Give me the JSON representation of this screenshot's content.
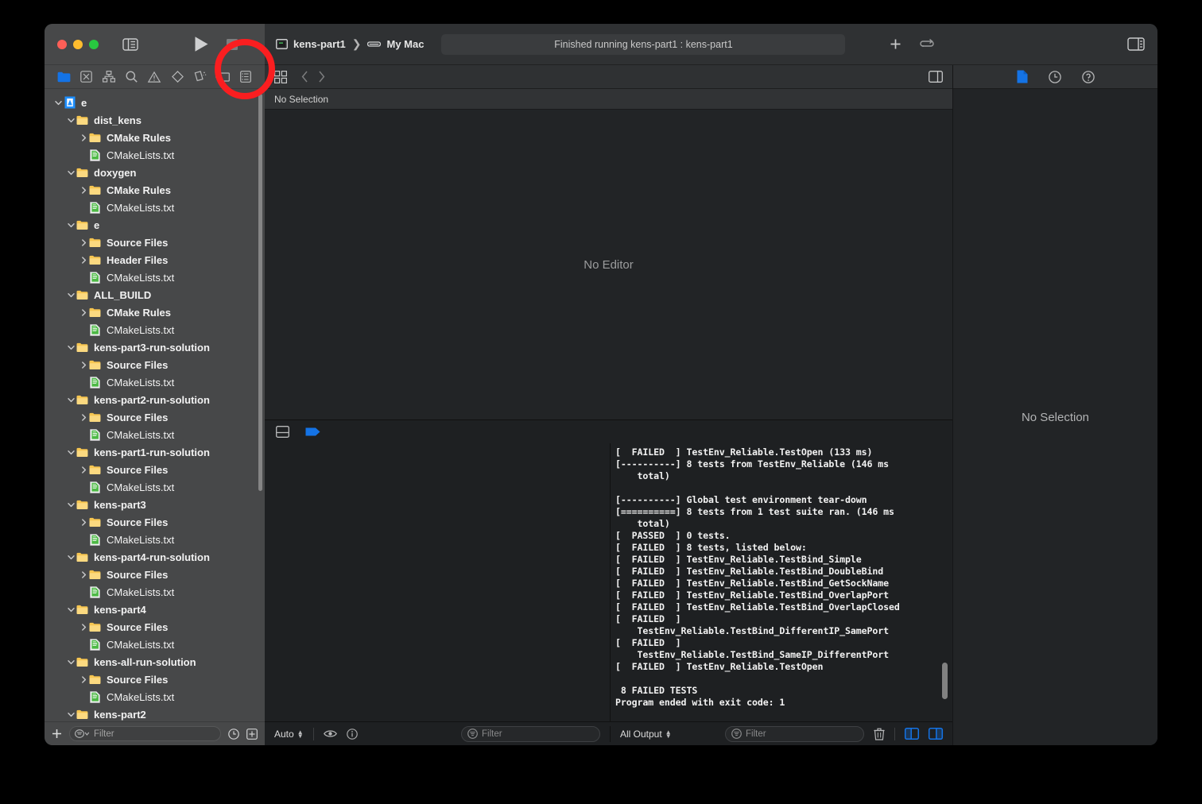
{
  "window": {
    "traffic_lights": [
      "close",
      "minimize",
      "zoom"
    ],
    "colors": {
      "close": "#ff5f57",
      "minimize": "#febc2e",
      "zoom": "#28c840",
      "accent": "#0a84ff",
      "annotation": "#fa1e20"
    }
  },
  "toolbar": {
    "sidebar_toggle_icon": "sidebar-left-icon",
    "run_icon": "play-icon",
    "stop_icon": "stop-icon",
    "scheme_name": "kens-part1",
    "scheme_separator": "❯",
    "destination": "My Mac",
    "activity_status": "Finished running kens-part1 : kens-part1",
    "add_icon": "plus-icon",
    "swap_icon": "swap-arrows-icon",
    "inspector_toggle_icon": "sidebar-right-icon"
  },
  "navigator": {
    "tabs": [
      {
        "name": "project-navigator",
        "icon": "folder-icon",
        "active": true
      },
      {
        "name": "source-control-navigator",
        "icon": "source-control-icon",
        "active": false
      },
      {
        "name": "symbol-navigator",
        "icon": "hierarchy-icon",
        "active": false
      },
      {
        "name": "find-navigator",
        "icon": "search-icon",
        "active": false
      },
      {
        "name": "issue-navigator",
        "icon": "warning-triangle-icon",
        "active": false
      },
      {
        "name": "test-navigator",
        "icon": "diamond-icon",
        "active": false
      },
      {
        "name": "debug-navigator",
        "icon": "debug-icon",
        "active": false
      },
      {
        "name": "breakpoint-navigator",
        "icon": "tag-icon",
        "active": false
      },
      {
        "name": "report-navigator",
        "icon": "list-icon",
        "active": false
      }
    ],
    "tree": [
      {
        "label": "e",
        "depth": 0,
        "type": "project",
        "twisty": "down"
      },
      {
        "label": "dist_kens",
        "depth": 1,
        "type": "folder",
        "twisty": "down"
      },
      {
        "label": "CMake Rules",
        "depth": 2,
        "type": "folder",
        "twisty": "right"
      },
      {
        "label": "CMakeLists.txt",
        "depth": 2,
        "type": "file",
        "twisty": "none"
      },
      {
        "label": "doxygen",
        "depth": 1,
        "type": "folder",
        "twisty": "down"
      },
      {
        "label": "CMake Rules",
        "depth": 2,
        "type": "folder",
        "twisty": "right"
      },
      {
        "label": "CMakeLists.txt",
        "depth": 2,
        "type": "file",
        "twisty": "none"
      },
      {
        "label": "e",
        "depth": 1,
        "type": "folder",
        "twisty": "down"
      },
      {
        "label": "Source Files",
        "depth": 2,
        "type": "folder",
        "twisty": "right"
      },
      {
        "label": "Header Files",
        "depth": 2,
        "type": "folder",
        "twisty": "right"
      },
      {
        "label": "CMakeLists.txt",
        "depth": 2,
        "type": "file",
        "twisty": "none"
      },
      {
        "label": "ALL_BUILD",
        "depth": 1,
        "type": "folder",
        "twisty": "down"
      },
      {
        "label": "CMake Rules",
        "depth": 2,
        "type": "folder",
        "twisty": "right"
      },
      {
        "label": "CMakeLists.txt",
        "depth": 2,
        "type": "file",
        "twisty": "none"
      },
      {
        "label": "kens-part3-run-solution",
        "depth": 1,
        "type": "folder",
        "twisty": "down"
      },
      {
        "label": "Source Files",
        "depth": 2,
        "type": "folder",
        "twisty": "right"
      },
      {
        "label": "CMakeLists.txt",
        "depth": 2,
        "type": "file",
        "twisty": "none"
      },
      {
        "label": "kens-part2-run-solution",
        "depth": 1,
        "type": "folder",
        "twisty": "down"
      },
      {
        "label": "Source Files",
        "depth": 2,
        "type": "folder",
        "twisty": "right"
      },
      {
        "label": "CMakeLists.txt",
        "depth": 2,
        "type": "file",
        "twisty": "none"
      },
      {
        "label": "kens-part1-run-solution",
        "depth": 1,
        "type": "folder",
        "twisty": "down"
      },
      {
        "label": "Source Files",
        "depth": 2,
        "type": "folder",
        "twisty": "right"
      },
      {
        "label": "CMakeLists.txt",
        "depth": 2,
        "type": "file",
        "twisty": "none"
      },
      {
        "label": "kens-part3",
        "depth": 1,
        "type": "folder",
        "twisty": "down"
      },
      {
        "label": "Source Files",
        "depth": 2,
        "type": "folder",
        "twisty": "right"
      },
      {
        "label": "CMakeLists.txt",
        "depth": 2,
        "type": "file",
        "twisty": "none"
      },
      {
        "label": "kens-part4-run-solution",
        "depth": 1,
        "type": "folder",
        "twisty": "down"
      },
      {
        "label": "Source Files",
        "depth": 2,
        "type": "folder",
        "twisty": "right"
      },
      {
        "label": "CMakeLists.txt",
        "depth": 2,
        "type": "file",
        "twisty": "none"
      },
      {
        "label": "kens-part4",
        "depth": 1,
        "type": "folder",
        "twisty": "down"
      },
      {
        "label": "Source Files",
        "depth": 2,
        "type": "folder",
        "twisty": "right"
      },
      {
        "label": "CMakeLists.txt",
        "depth": 2,
        "type": "file",
        "twisty": "none"
      },
      {
        "label": "kens-all-run-solution",
        "depth": 1,
        "type": "folder",
        "twisty": "down"
      },
      {
        "label": "Source Files",
        "depth": 2,
        "type": "folder",
        "twisty": "right"
      },
      {
        "label": "CMakeLists.txt",
        "depth": 2,
        "type": "file",
        "twisty": "none"
      },
      {
        "label": "kens-part2",
        "depth": 1,
        "type": "folder",
        "twisty": "down"
      }
    ],
    "footer": {
      "add_icon": "plus-icon",
      "filter_placeholder": "Filter",
      "filter_value": "",
      "recent_icon": "clock-icon",
      "sourcecontrol_icon": "add-box-icon"
    }
  },
  "editor": {
    "grid_icon": "grid-icon",
    "back_icon": "chevron-left-icon",
    "forward_icon": "chevron-right-icon",
    "split_icon": "split-editor-icon",
    "jumpbar_text": "No Selection",
    "placeholder": "No Editor"
  },
  "debug_area": {
    "toolbar": {
      "layout_icon": "panel-layout-icon",
      "continue_icon": "continue-flag-icon"
    },
    "console_text": "[  FAILED  ] TestEnv_Reliable.TestOpen (133 ms)\n[----------] 8 tests from TestEnv_Reliable (146 ms\n    total)\n\n[----------] Global test environment tear-down\n[==========] 8 tests from 1 test suite ran. (146 ms\n    total)\n[  PASSED  ] 0 tests.\n[  FAILED  ] 8 tests, listed below:\n[  FAILED  ] TestEnv_Reliable.TestBind_Simple\n[  FAILED  ] TestEnv_Reliable.TestBind_DoubleBind\n[  FAILED  ] TestEnv_Reliable.TestBind_GetSockName\n[  FAILED  ] TestEnv_Reliable.TestBind_OverlapPort\n[  FAILED  ] TestEnv_Reliable.TestBind_OverlapClosed\n[  FAILED  ]\n    TestEnv_Reliable.TestBind_DifferentIP_SamePort\n[  FAILED  ]\n    TestEnv_Reliable.TestBind_SameIP_DifferentPort\n[  FAILED  ] TestEnv_Reliable.TestOpen\n\n 8 FAILED TESTS\nProgram ended with exit code: 1",
    "footer": {
      "scope_label": "Auto",
      "eye_icon": "eye-icon",
      "info_icon": "info-circle-icon",
      "variables_filter_placeholder": "Filter",
      "variables_filter_value": "",
      "output_label": "All Output",
      "console_filter_placeholder": "Filter",
      "console_filter_value": "",
      "trash_icon": "trash-icon",
      "show_variables_icon": "show-variables-pane-icon",
      "show_console_icon": "show-console-pane-icon"
    }
  },
  "inspector": {
    "tabs": [
      {
        "name": "file-inspector",
        "icon": "document-icon",
        "active": true
      },
      {
        "name": "history-inspector",
        "icon": "clock-icon",
        "active": false
      },
      {
        "name": "quick-help-inspector",
        "icon": "question-circle-icon",
        "active": false
      }
    ],
    "placeholder": "No Selection"
  },
  "annotation": {
    "shape": "circle",
    "target": "run-button",
    "color": "#fa1e20"
  }
}
